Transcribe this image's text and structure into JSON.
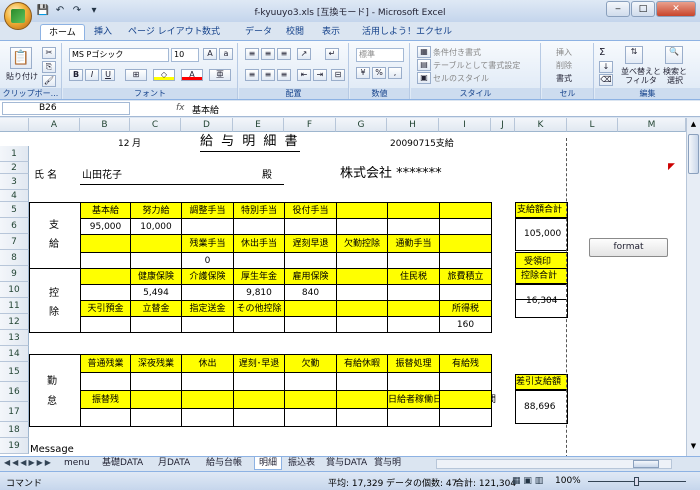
{
  "window": {
    "title": "f-kyuuyo3.xls  [互換モード] - Microsoft Excel",
    "buttons": [
      "‒",
      "□",
      "✕"
    ]
  },
  "qat": [
    "💾",
    "↶",
    "↷",
    "▾"
  ],
  "tabs": [
    "ホーム",
    "挿入",
    "ページ レイアウト",
    "数式",
    "データ",
    "校閲",
    "表示",
    "活用しよう！エクセル"
  ],
  "ribbon": {
    "clipboard": {
      "paste": "貼り付け",
      "label": "クリップボー..."
    },
    "font": {
      "name": "MS Pゴシック",
      "size": "10",
      "label": "フォント",
      "bold": "B",
      "italic": "I",
      "underline": "U"
    },
    "alignment": {
      "label": "配置"
    },
    "number": {
      "format": "標準",
      "label": "数値",
      "pct": "%",
      "comma": ","
    },
    "styles": {
      "cond": "条件付き書式",
      "table": "テーブルとして書式設定",
      "cell": "セルのスタイル",
      "label": "スタイル"
    },
    "cells": {
      "insert": "挿入",
      "delete": "削除",
      "format": "書式",
      "label": "セル"
    },
    "editing": {
      "sigma": "Σ",
      "sort": "並べ替えと\nフィルタ",
      "find": "検索と\n選択",
      "label": "編集"
    }
  },
  "formula": {
    "name_box": "B26",
    "fx": "fx",
    "value": "基本給"
  },
  "columns": [
    "A",
    "B",
    "C",
    "D",
    "E",
    "F",
    "G",
    "H",
    "I",
    "J",
    "K",
    "L",
    "M"
  ],
  "rows": [
    "1",
    "2",
    "3",
    "4",
    "5",
    "6",
    "7",
    "8",
    "9",
    "10",
    "11",
    "12",
    "13",
    "14",
    "15",
    "16",
    "17",
    "18",
    "19"
  ],
  "sheet": {
    "month_num": "12",
    "month_unit": "月",
    "title": "給 与 明 細 書",
    "date": "20090715支給",
    "stamp": "受領印",
    "name_label": "氏 名",
    "name": "山田花子",
    "honorific": "殿",
    "company": "株式会社 *******",
    "pay_label1": "支",
    "pay_label2": "給",
    "pay_h1": [
      "基本給",
      "努力給",
      "調整手当",
      "特別手当",
      "役付手当",
      "",
      "",
      ""
    ],
    "pay_v1": [
      "95,000",
      "10,000",
      "",
      "",
      "",
      "",
      "",
      ""
    ],
    "pay_h2": [
      "",
      "",
      "残業手当",
      "休出手当",
      "遅刻早退",
      "欠勤控除",
      "通勤手当",
      ""
    ],
    "pay_v2": [
      "",
      "",
      "0",
      "",
      "",
      "",
      "",
      ""
    ],
    "pay_total_label": "支給額合計",
    "pay_total": "105,000",
    "ded_label1": "控",
    "ded_label2": "除",
    "ded_h1": [
      "",
      "健康保険",
      "介護保険",
      "厚生年金",
      "雇用保険",
      "",
      "住民税",
      "旅費積立"
    ],
    "ded_v1": [
      "",
      "5,494",
      "",
      "9,810",
      "840",
      "",
      "",
      ""
    ],
    "ded_h2": [
      "天引預金",
      "立替金",
      "指定送金",
      "その他控除",
      "",
      "",
      "",
      "所得税"
    ],
    "ded_v2": [
      "",
      "",
      "",
      "",
      "",
      "",
      "",
      "160"
    ],
    "ded_total_label": "控除合計",
    "ded_total": "16,304",
    "att_label1": "勤",
    "att_label2": "怠",
    "att_h1": [
      "普通残業",
      "深夜残業",
      "休出",
      "遅刻･早退",
      "欠勤",
      "有給休暇",
      "振替処理",
      "有給残"
    ],
    "att_h2": [
      "振替残",
      "",
      "",
      "",
      "",
      "",
      "日給者稼働日給者稼働時間",
      ""
    ],
    "net_label": "差引支給額",
    "net_total": "88,696",
    "message": "Message",
    "button": "format"
  },
  "sheet_tabs": [
    "menu",
    "基礎DATA",
    "月DATA",
    "給与台帳",
    "明細",
    "振込表",
    "賞与DATA",
    "賞与明"
  ],
  "active_sheet": "明細",
  "status": {
    "mode": "コマンド",
    "avg": "平均: 17,329",
    "count": "データの個数: 47",
    "sum": "合計: 121,304",
    "zoom": "100%"
  }
}
